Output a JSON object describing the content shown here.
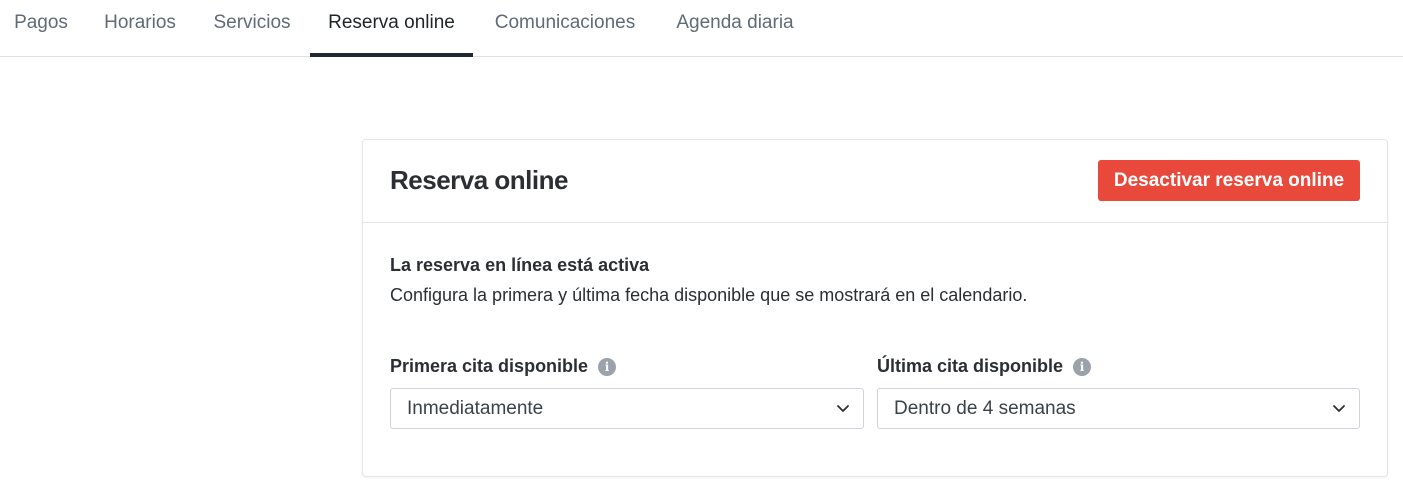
{
  "tabs": [
    {
      "label": "Pagos",
      "active": false
    },
    {
      "label": "Horarios",
      "active": false
    },
    {
      "label": "Servicios",
      "active": false
    },
    {
      "label": "Reserva online",
      "active": true
    },
    {
      "label": "Comunicaciones",
      "active": false
    },
    {
      "label": "Agenda diaria",
      "active": false
    }
  ],
  "card": {
    "title": "Reserva online",
    "deactivate_label": "Desactivar reserva online",
    "status_title": "La reserva en línea está activa",
    "status_description": "Configura la primera y última fecha disponible que se mostrará en el calendario.",
    "first_field": {
      "label": "Primera cita disponible",
      "value": "Inmediatamente",
      "icon": "info-icon"
    },
    "last_field": {
      "label": "Última cita disponible",
      "value": "Dentro de 4 semanas",
      "icon": "info-icon"
    }
  },
  "colors": {
    "danger": "#e8493b",
    "active_tab_underline": "#1f2933",
    "muted_text": "#5f6b76"
  }
}
